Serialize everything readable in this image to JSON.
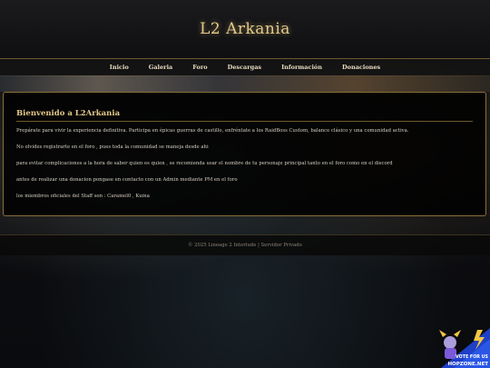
{
  "header": {
    "title": "L2 Arkania"
  },
  "nav": {
    "items": [
      {
        "label": "Inicio"
      },
      {
        "label": "Galeria"
      },
      {
        "label": "Foro"
      },
      {
        "label": "Descargas"
      },
      {
        "label": "Información"
      },
      {
        "label": "Donaciones"
      }
    ]
  },
  "main": {
    "heading": "Bienvenido a L2Arkania",
    "paragraphs": [
      "Prepárate para vivir la experiencia definitiva. Participa en épicas guerras de castillo, enfréntate a los RaidBoss Custom, balance clásico y una comunidad activa.",
      "No olvides registrarte en el foro , pues toda la comunidad se maneja desde ahi",
      "para evitar complicaciones a la hora de saber quien es quien , se recomienda usar el nombre de tu personaje principal tanto en el foro como en el discord",
      "antes de realizar una donacion pongase en contacto con un Admin mediante PM en el foro",
      "los miembros oficiales del Staff son : Caramel0 , Kuina"
    ]
  },
  "footer": {
    "text": "© 2025 Lineage 2 Interlude | Servidor Privado"
  },
  "vote_badge": {
    "text": "VOTE FOR US",
    "brand": "HOPZONE.NET",
    "colors": {
      "accent": "#1e40c8",
      "bolt": "#f2c744"
    }
  },
  "colors": {
    "gold": "#e3c98a",
    "border": "#8a6f38",
    "text": "#d5cfc3"
  }
}
